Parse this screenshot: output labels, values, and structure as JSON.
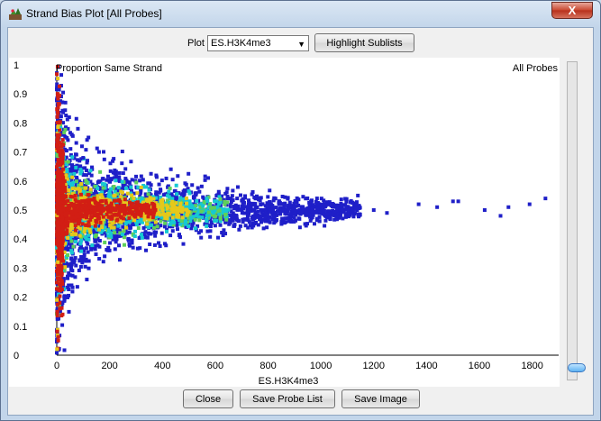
{
  "window": {
    "title": "Strand Bias Plot [All Probes]",
    "close_symbol": "X"
  },
  "toolbar": {
    "plot_label": "Plot",
    "plot_select_value": "ES.H3K4me3",
    "highlight_button": "Highlight Sublists"
  },
  "footer": {
    "close_button": "Close",
    "save_list_button": "Save Probe List",
    "save_image_button": "Save Image"
  },
  "colors": {
    "low_density": "#1f1fc8",
    "mid_density": "#16c8d2",
    "mid2_density": "#5fd05a",
    "high_density": "#e6c81a",
    "max_density": "#d21e14"
  },
  "slider": {
    "value": 0.0
  },
  "chart_data": {
    "type": "scatter",
    "ylabel": "Proportion Same Strand",
    "xlabel": "ES.H3K4me3",
    "corner_label": "All Probes",
    "xlim": [
      0,
      1900
    ],
    "ylim": [
      0,
      1
    ],
    "x_ticks": [
      "0",
      "200",
      "400",
      "600",
      "800",
      "1000",
      "1200",
      "1400",
      "1600",
      "1800"
    ],
    "y_ticks": [
      "0",
      "0.1",
      "0.2",
      "0.3",
      "0.4",
      "0.5",
      "0.6",
      "0.7",
      "0.8",
      "0.9",
      "1"
    ],
    "grid": false,
    "density_bands": [
      {
        "x": 0,
        "spread": 0.5,
        "level": "max"
      },
      {
        "x": 50,
        "spread": 0.22,
        "level": "max"
      },
      {
        "x": 100,
        "spread": 0.17,
        "level": "high"
      },
      {
        "x": 200,
        "spread": 0.14,
        "level": "high"
      },
      {
        "x": 300,
        "spread": 0.12,
        "level": "mid"
      },
      {
        "x": 400,
        "spread": 0.1,
        "level": "mid"
      },
      {
        "x": 500,
        "spread": 0.08,
        "level": "low"
      },
      {
        "x": 600,
        "spread": 0.07,
        "level": "low"
      },
      {
        "x": 800,
        "spread": 0.05,
        "level": "low"
      },
      {
        "x": 1000,
        "spread": 0.04,
        "level": "low"
      },
      {
        "x": 1100,
        "spread": 0.03,
        "level": "low"
      }
    ],
    "outliers": [
      {
        "x": 1200,
        "y": 0.5
      },
      {
        "x": 1250,
        "y": 0.49
      },
      {
        "x": 1370,
        "y": 0.52
      },
      {
        "x": 1440,
        "y": 0.51
      },
      {
        "x": 1500,
        "y": 0.53
      },
      {
        "x": 1520,
        "y": 0.53
      },
      {
        "x": 1620,
        "y": 0.5
      },
      {
        "x": 1680,
        "y": 0.48
      },
      {
        "x": 1710,
        "y": 0.51
      },
      {
        "x": 1790,
        "y": 0.52
      },
      {
        "x": 1850,
        "y": 0.54
      },
      {
        "x": 1060,
        "y": 0.5
      },
      {
        "x": 1130,
        "y": 0.49
      },
      {
        "x": 1140,
        "y": 0.55
      },
      {
        "x": 120,
        "y": 0.75
      },
      {
        "x": 80,
        "y": 0.78
      },
      {
        "x": 160,
        "y": 0.7
      },
      {
        "x": 100,
        "y": 0.68
      }
    ]
  }
}
